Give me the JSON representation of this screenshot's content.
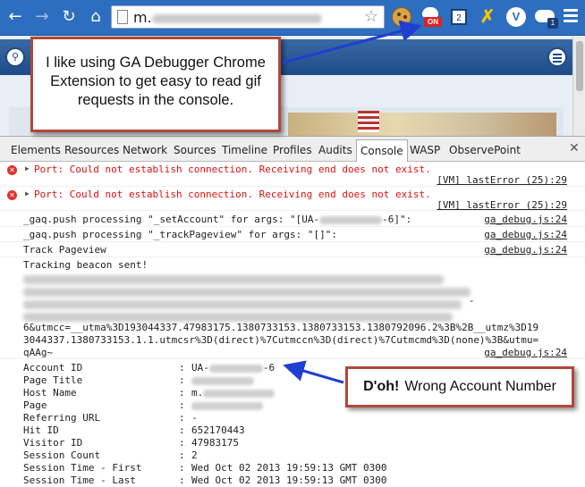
{
  "browser": {
    "url_prefix": "m.",
    "menu_label": "Chrome menu"
  },
  "devtools": {
    "tabs": [
      "Elements",
      "Resources",
      "Network",
      "Sources",
      "Timeline",
      "Profiles",
      "Audits",
      "Console",
      "WASP",
      "ObservePoint"
    ],
    "active_tab": "Console"
  },
  "console": {
    "errors": [
      {
        "text": "Port: Could not establish connection. Receiving end does not exist.",
        "source": "[VM] lastError (25):29"
      },
      {
        "text": "Port: Could not establish connection. Receiving end does not exist.",
        "source": "[VM] lastError (25):29"
      }
    ],
    "gaq1": {
      "pre": "_gaq.push processing \"_setAccount\" for args: \"[UA-",
      "post": "-6]\":",
      "source": "ga_debug.js:24"
    },
    "gaq2": {
      "text": "_gaq.push processing \"_trackPageview\" for args: \"[]\":",
      "source": "ga_debug.js:24"
    },
    "track": {
      "text": "Track Pageview",
      "source": "ga_debug.js:24"
    },
    "beacon_title": "Tracking beacon sent!",
    "beacon_dash": "-",
    "beacon_lines": [
      "6&utmcc=__utma%3D193044337.47983175.1380733153.1380733153.1380792096.2%3B%2B__utmz%3D19",
      "3044337.1380733153.1.1.utmcsr%3D(direct)%7Cutmccn%3D(direct)%7Cutmcmd%3D(none)%3B&utmu=",
      "qAAg~"
    ],
    "beacon_source": "ga_debug.js:24",
    "fields": [
      {
        "label": "Account ID",
        "value_pre": "UA-",
        "value_post": "-6"
      },
      {
        "label": "Page Title",
        "value_pre": "",
        "value_post": ""
      },
      {
        "label": "Host Name",
        "value_pre": "m.",
        "value_post": ""
      },
      {
        "label": "Page",
        "value_pre": "",
        "value_post": ""
      },
      {
        "label": "Referring URL",
        "value_pre": "-",
        "value_post": ""
      },
      {
        "label": "Hit ID",
        "value_pre": "652170443",
        "value_post": ""
      },
      {
        "label": "Visitor ID",
        "value_pre": "47983175",
        "value_post": ""
      },
      {
        "label": "Session Count",
        "value_pre": "2",
        "value_post": ""
      },
      {
        "label": "Session Time - First",
        "value_pre": "Wed Oct 02 2013 19:59:13 GMT 0300",
        "value_post": ""
      },
      {
        "label": "Session Time - Last",
        "value_pre": "Wed Oct 02 2013 19:59:13 GMT 0300",
        "value_post": ""
      }
    ],
    "field_sep": ":"
  },
  "annotations": {
    "callout1": "I like using GA Debugger Chrome Extension to get easy to read gif requests in the console.",
    "callout2_bold": "D'oh!",
    "callout2_text": "Wrong Account Number",
    "arrow_color": "#1f3fd0",
    "border_color": "#b0483a"
  },
  "extension_badges": {
    "ga_debugger": "ON",
    "tab_count": "2",
    "cloud_count": "1"
  }
}
